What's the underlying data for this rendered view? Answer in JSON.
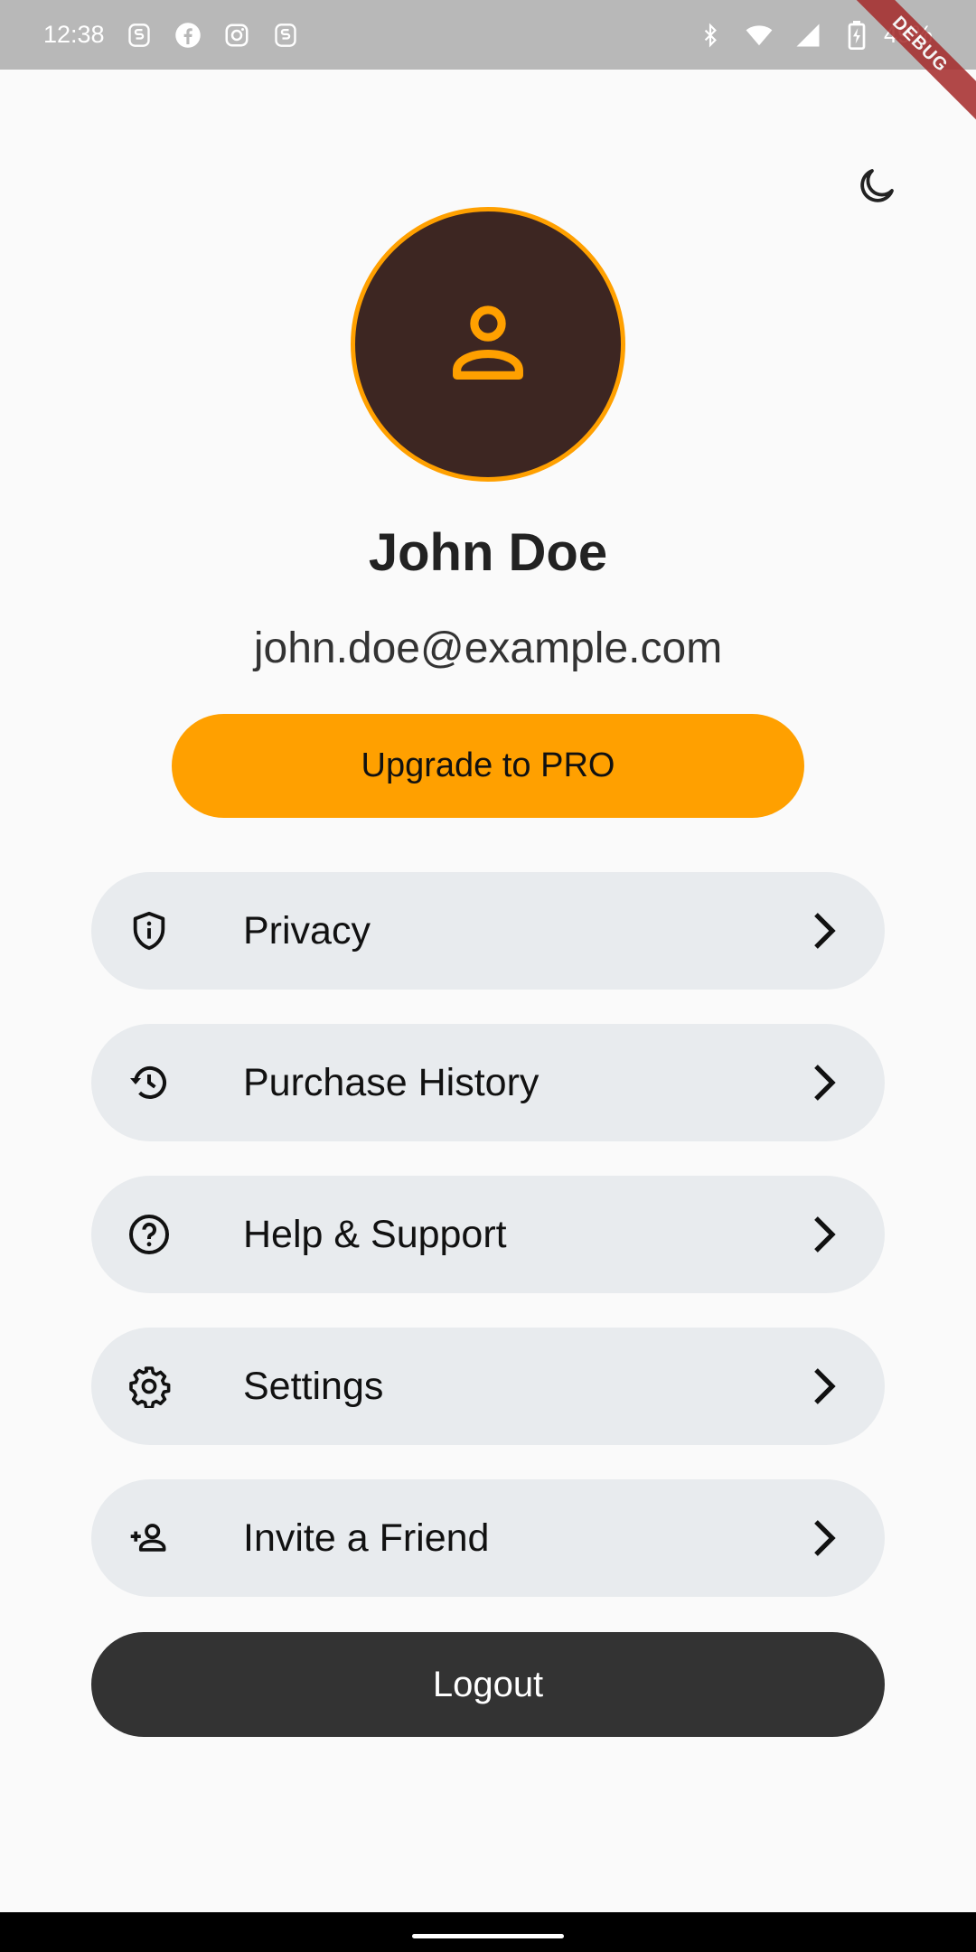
{
  "status_bar": {
    "time": "12:38",
    "notification_icons": [
      "s-app-icon",
      "facebook-icon",
      "instagram-icon",
      "s-app-icon"
    ],
    "system_icons": [
      "bluetooth-icon",
      "wifi-icon",
      "signal-icon",
      "battery-charging-icon"
    ],
    "battery": "49%"
  },
  "debug_banner": "DEBUG",
  "theme_toggle_icon": "moon-icon",
  "profile": {
    "avatar_icon": "person-icon",
    "name": "John Doe",
    "email": "john.doe@example.com"
  },
  "upgrade_button": "Upgrade to PRO",
  "menu": [
    {
      "label": "Privacy",
      "icon": "shield-info-icon"
    },
    {
      "label": "Purchase History",
      "icon": "history-icon"
    },
    {
      "label": "Help & Support",
      "icon": "help-circle-icon"
    },
    {
      "label": "Settings",
      "icon": "gear-icon"
    },
    {
      "label": "Invite a Friend",
      "icon": "person-add-icon"
    }
  ],
  "logout_button": "Logout",
  "colors": {
    "accent": "#ffa000",
    "avatar_bg": "#3d2622",
    "menu_bg": "#e8ebee",
    "logout_bg": "#333333",
    "status_bar": "#b8b8b8"
  }
}
